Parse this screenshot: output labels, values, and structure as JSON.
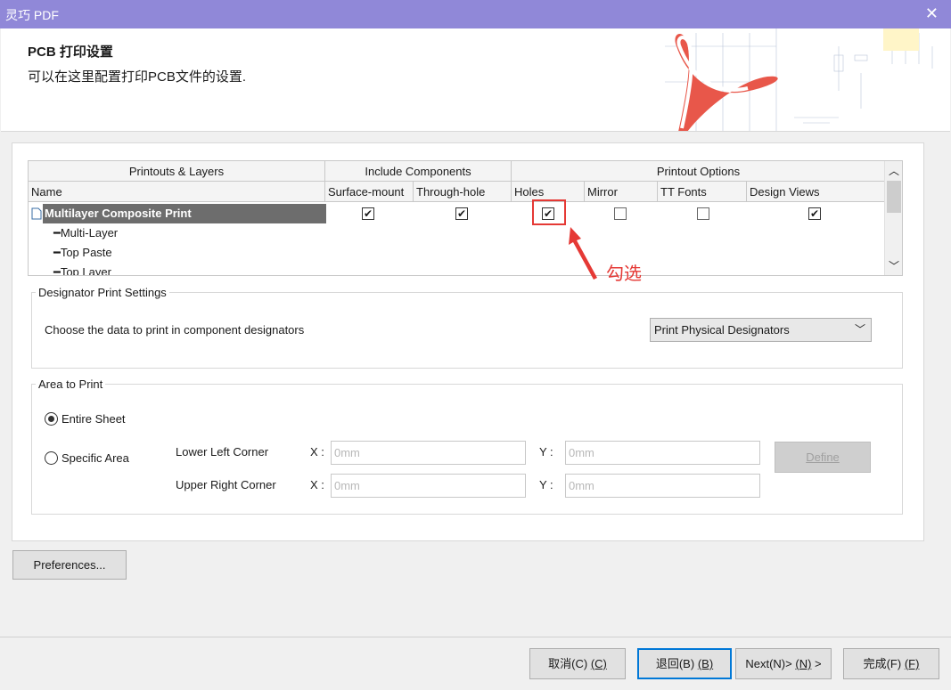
{
  "window": {
    "title": "灵巧 PDF",
    "close_glyph": "✕"
  },
  "header": {
    "title": "PCB 打印设置",
    "subtitle": "可以在这里配置打印PCB文件的设置."
  },
  "grid": {
    "group_headers": [
      "Printouts & Layers",
      "Include Components",
      "Printout Options"
    ],
    "columns": [
      "Name",
      "Surface-mount",
      "Through-hole",
      "Holes",
      "Mirror",
      "TT Fonts",
      "Design Views"
    ],
    "rows": [
      {
        "name": "Multilayer Composite Print",
        "selected": true,
        "checks": [
          true,
          true,
          true,
          false,
          false,
          true
        ]
      },
      {
        "name": "Multi-Layer"
      },
      {
        "name": "Top Paste"
      },
      {
        "name": "Top Layer"
      }
    ],
    "check_glyph": "✔",
    "scroll_up": "︿",
    "scroll_down": "﹀"
  },
  "annotation": {
    "text": "勾选",
    "color": "#e53935"
  },
  "designator": {
    "legend": "Designator Print Settings",
    "prompt": "Choose the data to print in component designators",
    "selected": "Print Physical Designators",
    "chev": "﹀"
  },
  "area": {
    "legend": "Area to Print",
    "entire_sheet": "Entire Sheet",
    "specific_area": "Specific Area",
    "selected": "entire_sheet",
    "lower_left": "Lower Left Corner",
    "upper_right": "Upper Right Corner",
    "x_label": "X :",
    "y_label": "Y :",
    "placeholder": "0mm",
    "define": "Define"
  },
  "preferences_button": "Preferences...",
  "footer": {
    "cancel": "取消(C)",
    "cancel_key": "(C)",
    "back": "退回(B)",
    "back_key": "(B)",
    "next": "Next(N)>",
    "next_key": "(N)",
    "next_suffix": ">",
    "finish": "完成(F)",
    "finish_key": "(F)"
  }
}
